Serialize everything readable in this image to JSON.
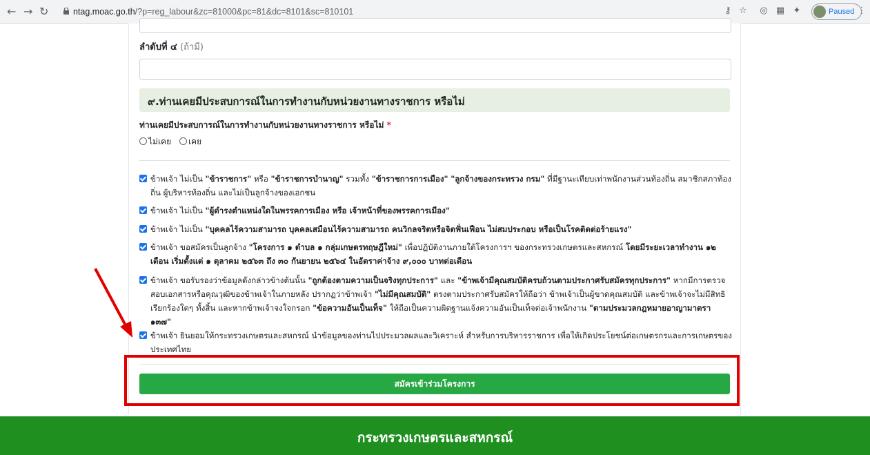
{
  "browser": {
    "url_host": "ntag.moac.go.th",
    "url_path": "/?p=reg_labour&zc=81000&pc=81&dc=8101&sc=810101",
    "profile_label": "Paused"
  },
  "form": {
    "order4_label": "ลำดับที่ ๔",
    "order4_optional": " (ถ้ามี)",
    "section9_title": "๙.ท่านเคยมีประสบการณ์ในการทำงานกับหน่วยงานทางราชการ หรือไม่",
    "q9_label": "ท่านเคยมีประสบการณ์ในการทำงานกับหน่วยงานทางราชการ หรือไม่",
    "q9_required": " *",
    "q9_options": [
      "ไม่เคย",
      "เคย"
    ],
    "declarations": [
      {
        "t1": "ข้าพเจ้า ไม่เป็น ",
        "b1": "\"ข้าราชการ\"",
        "t2": " หรือ ",
        "b2": "\"ข้าราชการบำนาญ\"",
        "t3": " รวมทั้ง ",
        "b3": "\"ข้าราชการการเมือง\"",
        "t4": " ",
        "b4": "\"ลูกจ้างของกระทรวง กรม\"",
        "t5": " ที่มีฐานะเทียบเท่าพนักงานส่วนท้องถิ่น สมาชิกสภาท้องถิ่น ผู้บริหารท้องถิ่น และไม่เป็นลูกจ้างของเอกชน"
      },
      {
        "t1": "ข้าพเจ้า ไม่เป็น ",
        "b1": "\"ผู้ดำรงตำแหน่งใดในพรรคการเมือง หรือ เจ้าหน้าที่ของพรรคการเมือง\""
      },
      {
        "t1": "ข้าพเจ้า ไม่เป็น ",
        "b1": "\"บุคคลไร้ความสามารถ บุคคลเสมือนไร้ความสามารถ คนวิกลจริตหรือจิตฟั่นเฟือน ไม่สมประกอบ หรือเป็นโรคติดต่อร้ายแรง\""
      },
      {
        "t1": "ข้าพเจ้า ขอสมัครเป็นลูกจ้าง  ",
        "b1": "\"โครงการ ๑ ตำบล ๑ กลุ่มเกษตรทฤษฎีใหม่\"",
        "t2": " เพื่อปฏิบัติงานภายใต้โครงการฯ ของกระทรวงเกษตรและสหกรณ์ ",
        "b2": "โดยมีระยะเวลาทำงาน ๑๒ เดือน เริ่มตั้งแต่ ๑ ตุลาคม ๒๕๖๓ ถึง ๓๐ กันยายน ๒๕๖๔ ในอัตราค่าจ้าง ๙,๐๐๐ บาทต่อเดือน"
      },
      {
        "t1": "ข้าพเจ้า ขอรับรองว่าข้อมูลดังกล่าวข้างต้นนั้น ",
        "b1": "\"ถูกต้องตามความเป็นจริงทุกประการ\"",
        "t2": " และ ",
        "b2": "\"ข้าพเจ้ามีคุณสมบัติครบถ้วนตามประกาศรับสมัครทุกประการ\"",
        "t3": " หากมีการตรวจสอบเอกสารหรือคุณวุฒิของข้าพเจ้าในภายหลัง ปรากฏว่าข้าพเจ้า ",
        "b3": "\"ไม่มีคุณสมบัติ\"",
        "t4": " ตรงตามประกาศรับสมัครให้ถือว่า ข้าพเจ้าเป็นผู้ขาดคุณสมบัติ และข้าพเจ้าจะไม่มีสิทธิเรียกร้องใดๆ ทั้งสิ้น และหากข้าพเจ้าจงใจกรอก ",
        "b4": "\"ข้อความอันเป็นเท็จ\"",
        "t5": " ให้ถือเป็นความผิดฐานแจ้งความอันเป็นเท็จต่อเจ้าพนักงาน ",
        "b5": "\"ตามประมวลกฎหมายอาญามาตรา ๑๓๗\""
      },
      {
        "t1": "ข้าพเจ้า ยินยอมให้กระทรวงเกษตรและสหกรณ์ นำข้อมูลของท่านไปประมวลผลและวิเคราะห์ สำหรับการบริหารราชการ เพื่อให้เกิดประโยชน์ต่อเกษตรกรและการเกษตรของประเทศไทย"
      }
    ],
    "submit_label": "สมัครเข้าร่วมโครงการ"
  },
  "footer": {
    "title": "กระทรวงเกษตรและสหกรณ์"
  },
  "colors": {
    "submit": "#28a745",
    "footer": "#1f8f1f",
    "highlight": "#e00000",
    "section_bg": "#e6efe2"
  }
}
